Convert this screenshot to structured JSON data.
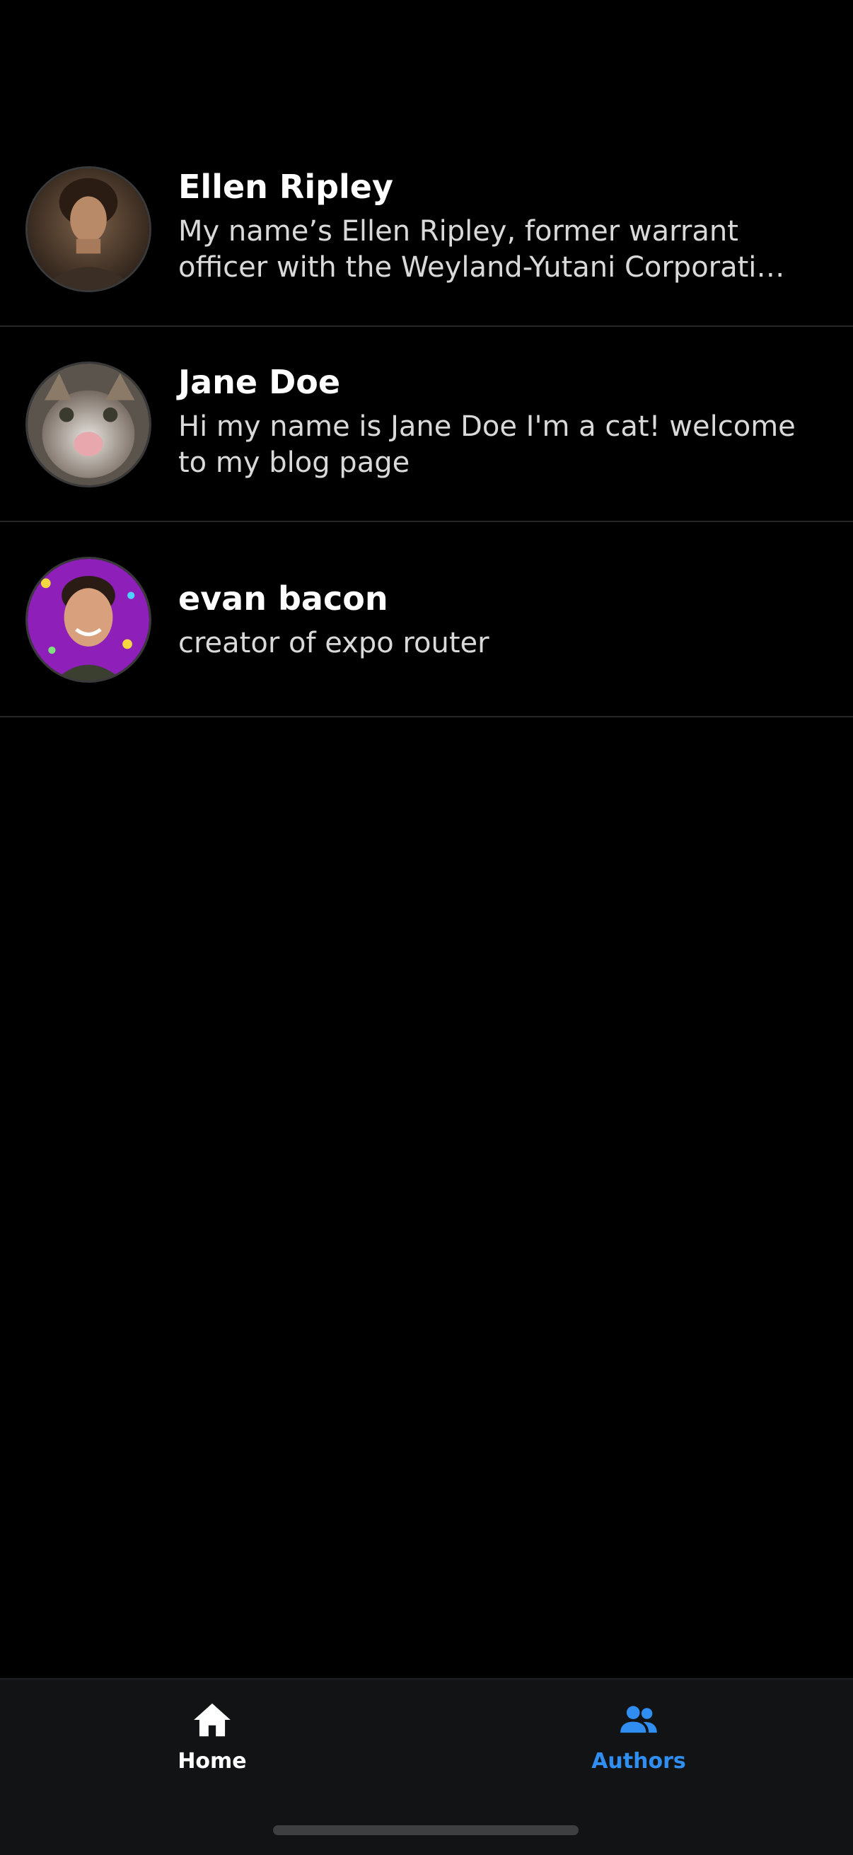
{
  "authors": [
    {
      "name": "Ellen Ripley",
      "bio": "My name’s Ellen Ripley, former warrant officer with the Weyland-Yutani Corporati…",
      "avatar": "ellen-ripley-photo"
    },
    {
      "name": "Jane Doe",
      "bio": "Hi my name is Jane Doe I'm a cat! welcome to my blog page",
      "avatar": "cat-photo"
    },
    {
      "name": "evan bacon",
      "bio": "creator of expo router",
      "avatar": "evan-bacon-photo"
    }
  ],
  "tab_bar": {
    "tabs": [
      {
        "label": "Home",
        "icon": "home-icon",
        "active": false
      },
      {
        "label": "Authors",
        "icon": "people-icon",
        "active": true
      }
    ],
    "active_color": "#2f8ef0",
    "inactive_color": "#ffffff"
  }
}
